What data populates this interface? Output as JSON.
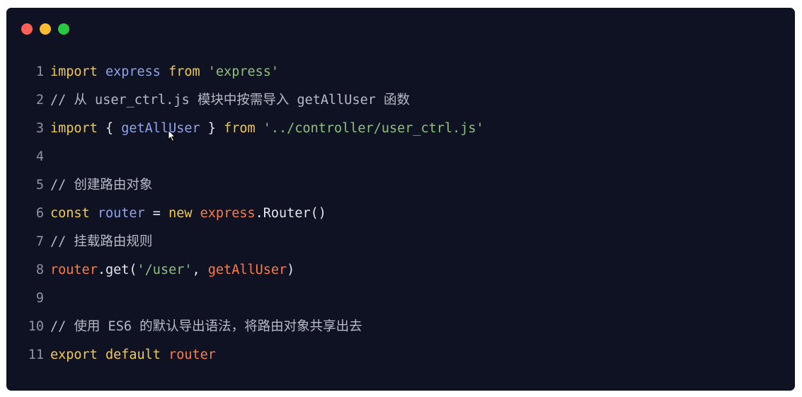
{
  "window": {
    "traffic_lights": [
      "close",
      "minimize",
      "maximize"
    ],
    "colors": {
      "background": "#0f1222",
      "red": "#fe5f57",
      "yellow": "#febc2e",
      "green": "#28c840"
    }
  },
  "code": {
    "lines": [
      {
        "n": "1",
        "tokens": [
          [
            "kw",
            "import"
          ],
          [
            "pl",
            " "
          ],
          [
            "var",
            "express"
          ],
          [
            "pl",
            " "
          ],
          [
            "kw",
            "from"
          ],
          [
            "pl",
            " "
          ],
          [
            "str",
            "'express'"
          ]
        ]
      },
      {
        "n": "2",
        "tokens": [
          [
            "cm",
            "// 从 user_ctrl.js 模块中按需导入 getAllUser 函数"
          ]
        ]
      },
      {
        "n": "3",
        "tokens": [
          [
            "kw",
            "import"
          ],
          [
            "pl",
            " { "
          ],
          [
            "var",
            "getAllUser"
          ],
          [
            "pl",
            " } "
          ],
          [
            "kw",
            "from"
          ],
          [
            "pl",
            " "
          ],
          [
            "str",
            "'../controller/user_ctrl.js'"
          ]
        ]
      },
      {
        "n": "4",
        "tokens": []
      },
      {
        "n": "5",
        "tokens": [
          [
            "cm",
            "// 创建路由对象"
          ]
        ]
      },
      {
        "n": "6",
        "tokens": [
          [
            "kw",
            "const"
          ],
          [
            "pl",
            " "
          ],
          [
            "var",
            "router"
          ],
          [
            "pl",
            " = "
          ],
          [
            "kw",
            "new"
          ],
          [
            "pl",
            " "
          ],
          [
            "call",
            "express"
          ],
          [
            "pl",
            ".Router()"
          ]
        ]
      },
      {
        "n": "7",
        "tokens": [
          [
            "cm",
            "// 挂载路由规则"
          ]
        ]
      },
      {
        "n": "8",
        "tokens": [
          [
            "call",
            "router"
          ],
          [
            "pl",
            ".get("
          ],
          [
            "str",
            "'/user'"
          ],
          [
            "pl",
            ", "
          ],
          [
            "call",
            "getAllUser"
          ],
          [
            "pl",
            ")"
          ]
        ]
      },
      {
        "n": "9",
        "tokens": []
      },
      {
        "n": "10",
        "tokens": [
          [
            "cm",
            "// 使用 ES6 的默认导出语法，将路由对象共享出去"
          ]
        ]
      },
      {
        "n": "11",
        "tokens": [
          [
            "kw",
            "export"
          ],
          [
            "pl",
            " "
          ],
          [
            "kw",
            "default"
          ],
          [
            "pl",
            " "
          ],
          [
            "call",
            "router"
          ]
        ]
      }
    ]
  }
}
